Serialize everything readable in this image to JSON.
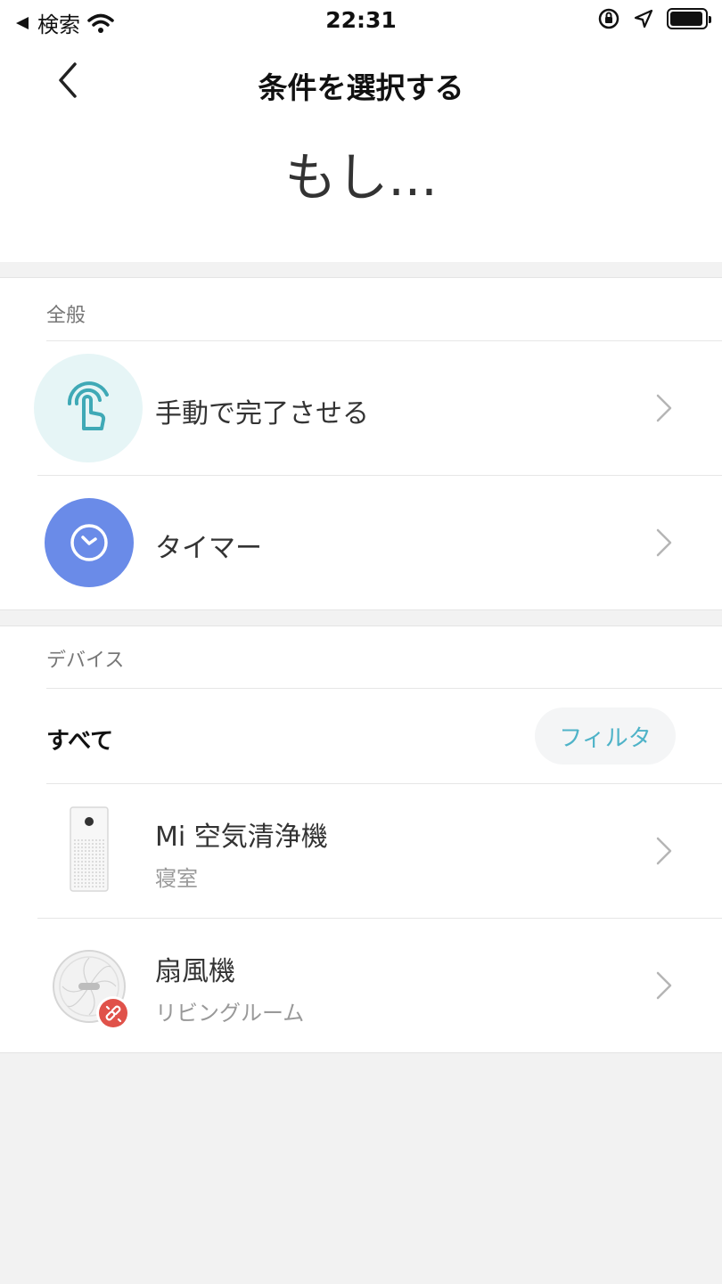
{
  "status_bar": {
    "back_app": "検索",
    "time": "22:31",
    "battery_percent": 95
  },
  "nav": {
    "title": "条件を選択する"
  },
  "heading": "もし...",
  "general": {
    "label": "全般",
    "items": [
      {
        "label": "手動で完了させる",
        "icon": "tap-hand-icon"
      },
      {
        "label": "タイマー",
        "icon": "clock-icon"
      }
    ]
  },
  "devices": {
    "label": "デバイス",
    "filter_all": "すべて",
    "filter_button": "フィルタ",
    "items": [
      {
        "name": "Mi 空気清浄機",
        "room": "寝室",
        "icon": "air-purifier-icon"
      },
      {
        "name": "扇風機",
        "room": "リビングルーム",
        "icon": "fan-icon",
        "badge": "disconnected-link-icon"
      }
    ]
  },
  "colors": {
    "accent_teal": "#4fb3c8",
    "timer_blue": "#6a8be8",
    "tap_bg": "#e6f5f6",
    "badge_red": "#e0524a"
  }
}
